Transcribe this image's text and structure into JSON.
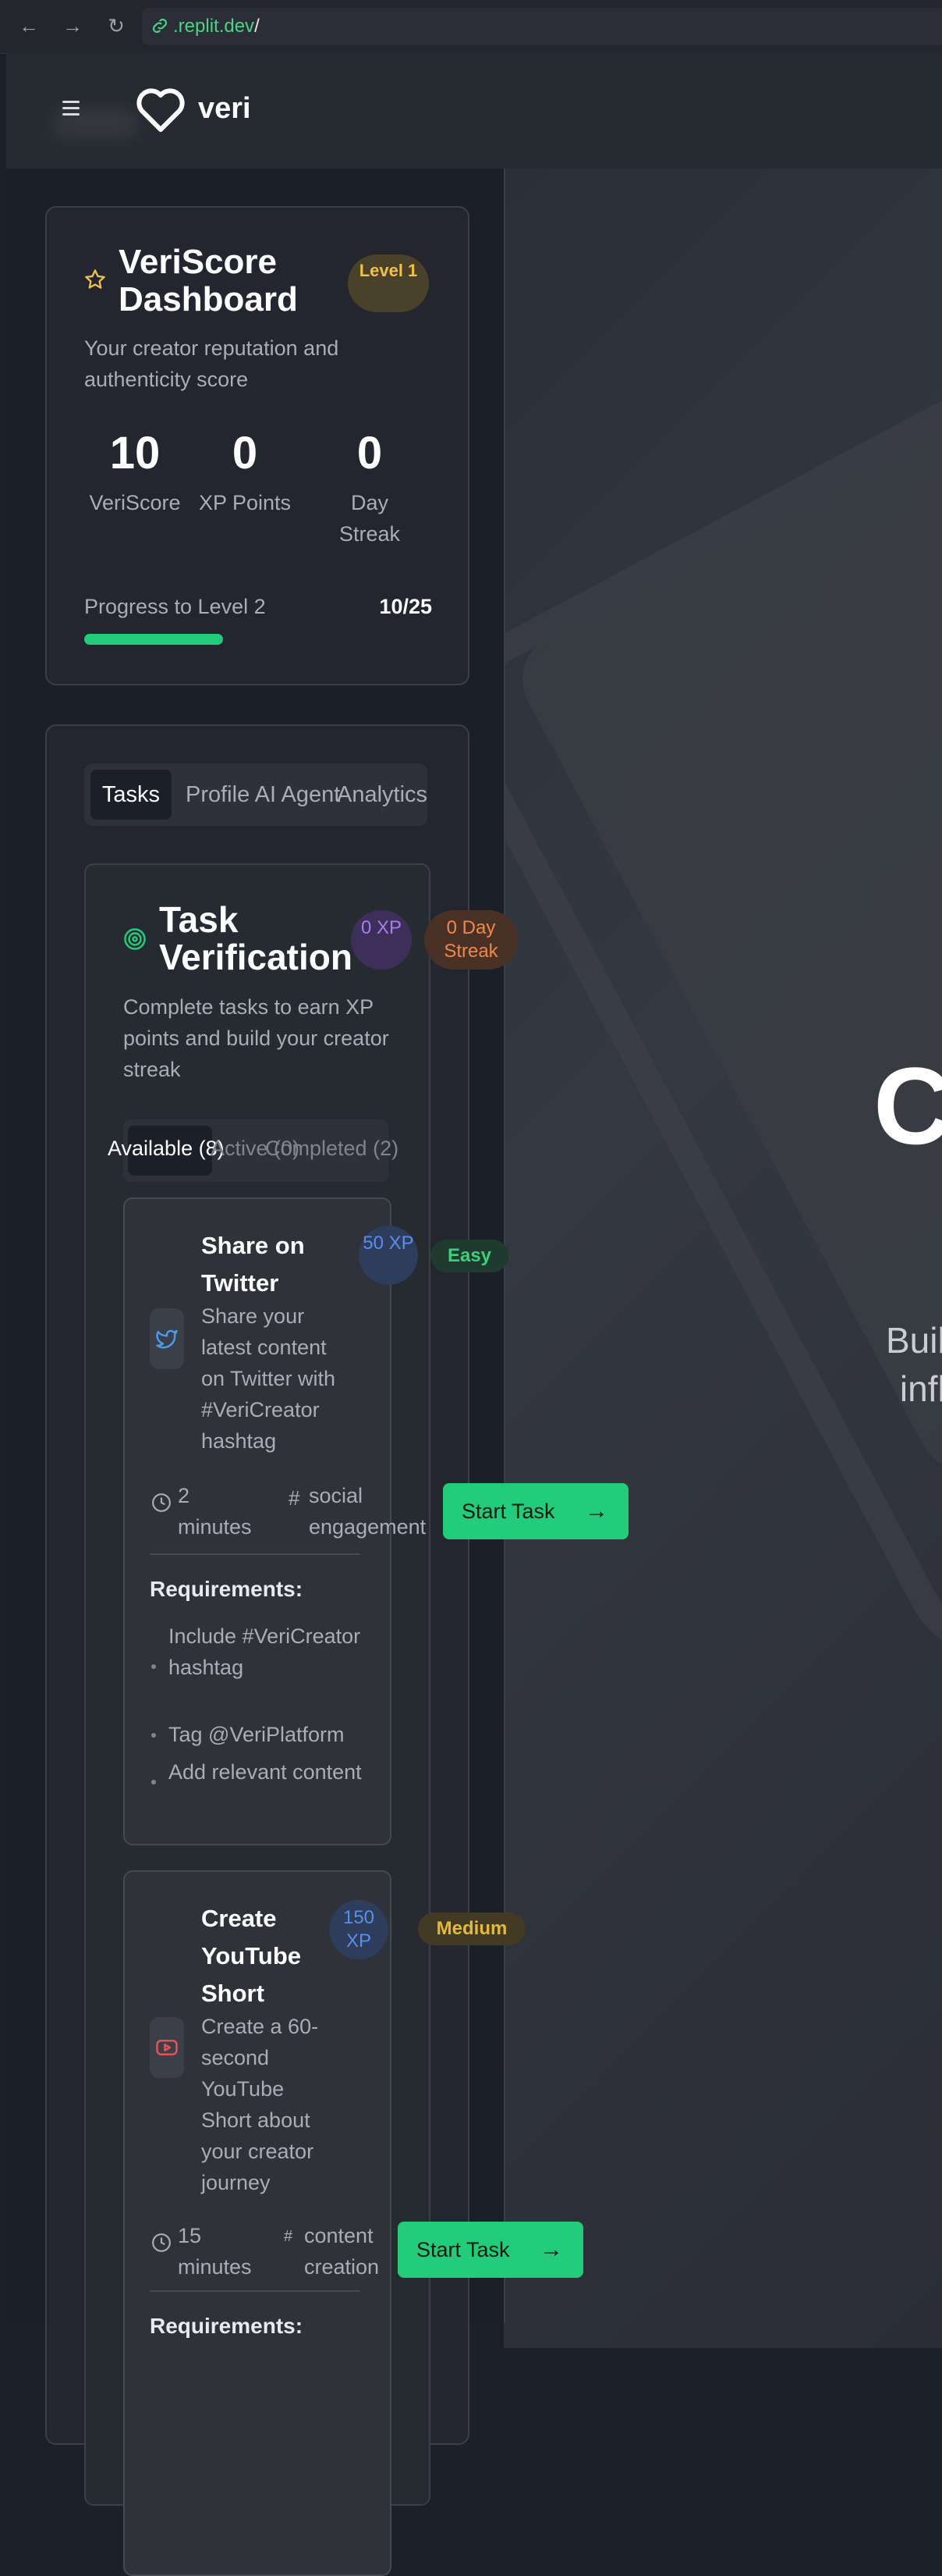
{
  "browser": {
    "url_domain": ".replit.dev",
    "url_path": "/"
  },
  "header": {
    "logo_text": "veri"
  },
  "score_card": {
    "title": "VeriScore Dashboard",
    "level_badge": "Level 1",
    "subtitle": "Your creator reputation and authenticity score",
    "stats": [
      {
        "value": "10",
        "label": "VeriScore"
      },
      {
        "value": "0",
        "label": "XP Points"
      },
      {
        "value": "0",
        "label": "Day Streak"
      }
    ],
    "progress_label": "Progress to Level 2",
    "progress_value": "10/25",
    "progress_fraction": 0.4
  },
  "tabs": [
    "Tasks",
    "Profile AI Agent",
    "Analytics"
  ],
  "verification": {
    "title": "Task Verification",
    "xp_badge": "0 XP",
    "streak_badge": "0 Day Streak",
    "subtitle": "Complete tasks to earn XP points and build your creator streak",
    "subtabs": [
      "Available (8)",
      "Active (0)",
      "Completed (2)"
    ]
  },
  "tasks": [
    {
      "title": "Share on Twitter",
      "xp": "50 XP",
      "difficulty": "Easy",
      "description": "Share your latest content on Twitter with #VeriCreator hashtag",
      "duration": "2 minutes",
      "category": "social engagement",
      "button": "Start Task",
      "requirements_title": "Requirements:",
      "requirements": [
        "Include #VeriCreator hashtag",
        "Tag @VeriPlatform",
        "Add relevant content"
      ]
    },
    {
      "title": "Create YouTube Short",
      "xp": "150 XP",
      "difficulty": "Medium",
      "description": "Create a 60-second YouTube Short about your creator journey",
      "duration": "15 minutes",
      "category": "content creation",
      "button": "Start Task",
      "requirements_title": "Requirements:"
    }
  ],
  "hero": {
    "letter": "C",
    "subtext_line1": "Buil",
    "subtext_line2": "infl"
  },
  "colors": {
    "accent_green": "#22cc7a",
    "background": "#1c2029",
    "level_badge": "#f0c14b",
    "xp_purple": "#a77df0",
    "streak_orange": "#f0874b"
  }
}
